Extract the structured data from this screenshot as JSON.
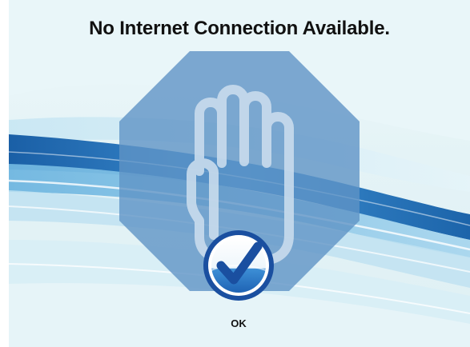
{
  "dialog": {
    "title": "No Internet Connection Available.",
    "ok_label": "OK"
  },
  "icons": {
    "main": "stop-hand-icon",
    "confirm": "checkmark-icon"
  },
  "colors": {
    "octagon": "#5f93c6",
    "hand_outline": "#c9dcec",
    "check_blue": "#1a4fa0",
    "wave_dark": "#1f6fb0",
    "wave_light": "#a9d5ea"
  }
}
